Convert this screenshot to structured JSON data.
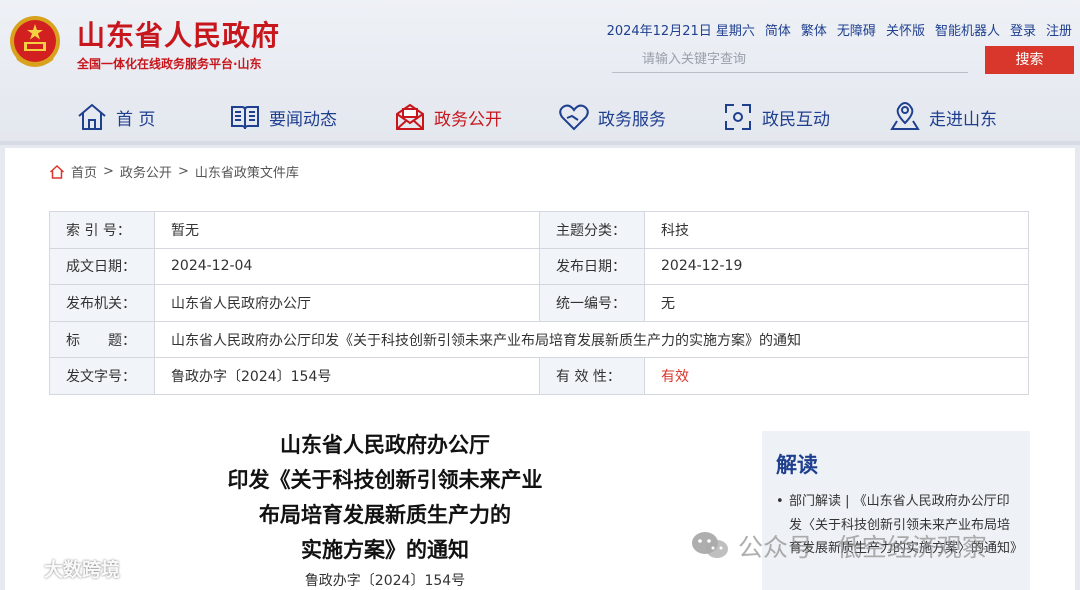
{
  "header": {
    "site_title": "山东省人民政府",
    "site_subtitle": "全国一体化在线政务服务平台·山东",
    "date": "2024年12月21日 星期六",
    "links": [
      "简体",
      "繁体",
      "无障碍",
      "关怀版",
      "智能机器人",
      "登录",
      "注册"
    ],
    "search": {
      "placeholder": "请输入关键字查询",
      "button": "搜索"
    },
    "nav": [
      {
        "label": "首 页",
        "icon": "home-icon"
      },
      {
        "label": "要闻动态",
        "icon": "book-icon"
      },
      {
        "label": "政务公开",
        "icon": "envelope-icon"
      },
      {
        "label": "政务服务",
        "icon": "heart-icon"
      },
      {
        "label": "政民互动",
        "icon": "interaction-icon"
      },
      {
        "label": "走进山东",
        "icon": "map-pin-icon"
      }
    ],
    "active_nav": "政务公开",
    "colors": {
      "brand_red": "#c8161d",
      "nav_blue": "#1f3f8f",
      "search_button": "#d9372b"
    }
  },
  "breadcrumb": {
    "items": [
      "首页",
      "政务公开",
      "山东省政策文件库"
    ],
    "separator": ">"
  },
  "meta": {
    "index_label": "索 引 号：",
    "index_value": "暂无",
    "topic_label": "主题分类：",
    "topic_value": "科技",
    "written_label": "成文日期：",
    "written_value": "2024-12-04",
    "published_label": "发布日期：",
    "published_value": "2024-12-19",
    "issuer_label": "发布机关：",
    "issuer_value": "山东省人民政府办公厅",
    "serial_label": "统一编号：",
    "serial_value": "无",
    "title_label": "标　　题：",
    "title_value": "山东省人民政府办公厅印发《关于科技创新引领未来产业布局培育发展新质生产力的实施方案》的通知",
    "docno_label": "发文字号：",
    "docno_value": "鲁政办字〔2024〕154号",
    "validity_label": "有 效 性：",
    "validity_value": "有效"
  },
  "document": {
    "title_lines": [
      "山东省人民政府办公厅",
      "印发《关于科技创新引领未来产业",
      "布局培育发展新质生产力的",
      "实施方案》的通知"
    ],
    "number": "鲁政办字〔2024〕154号"
  },
  "sidebar": {
    "title": "解读",
    "item": "部门解读 | 《山东省人民政府办公厅印发〈关于科技创新引领未来产业布局培育发展新质生产力的实施方案〉的通知》"
  },
  "watermarks": {
    "left": "大数跨境",
    "right": "公众号 · 低空经济观察"
  }
}
